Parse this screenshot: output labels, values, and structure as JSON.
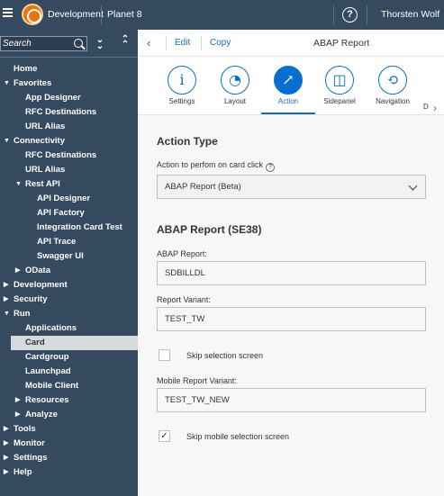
{
  "topbar": {
    "app_name": "Development",
    "space_name": "Planet 8",
    "user_name": "Thorsten Wolf",
    "help_glyph": "?"
  },
  "sidebar": {
    "search_placeholder": "Search",
    "selected_item": "Card",
    "items": [
      {
        "label": "Home",
        "level": 0,
        "arrow": ""
      },
      {
        "label": "Favorites",
        "level": 0,
        "arrow": "down"
      },
      {
        "label": "App Designer",
        "level": 1,
        "arrow": ""
      },
      {
        "label": "RFC Destinations",
        "level": 1,
        "arrow": ""
      },
      {
        "label": "URL Alias",
        "level": 1,
        "arrow": ""
      },
      {
        "label": "Connectivity",
        "level": 0,
        "arrow": "down"
      },
      {
        "label": "RFC Destinations",
        "level": 1,
        "arrow": ""
      },
      {
        "label": "URL Alias",
        "level": 1,
        "arrow": ""
      },
      {
        "label": "Rest API",
        "level": 1,
        "arrow": "down"
      },
      {
        "label": "API Designer",
        "level": 2,
        "arrow": ""
      },
      {
        "label": "API Factory",
        "level": 2,
        "arrow": ""
      },
      {
        "label": "Integration Card Test",
        "level": 2,
        "arrow": ""
      },
      {
        "label": "API Trace",
        "level": 2,
        "arrow": ""
      },
      {
        "label": "Swagger UI",
        "level": 2,
        "arrow": ""
      },
      {
        "label": "OData",
        "level": 1,
        "arrow": "right"
      },
      {
        "label": "Development",
        "level": 0,
        "arrow": "right"
      },
      {
        "label": "Security",
        "level": 0,
        "arrow": "right"
      },
      {
        "label": "Run",
        "level": 0,
        "arrow": "down"
      },
      {
        "label": "Applications",
        "level": 1,
        "arrow": ""
      },
      {
        "label": "Card",
        "level": 1,
        "arrow": ""
      },
      {
        "label": "Cardgroup",
        "level": 1,
        "arrow": ""
      },
      {
        "label": "Launchpad",
        "level": 1,
        "arrow": ""
      },
      {
        "label": "Mobile Client",
        "level": 1,
        "arrow": ""
      },
      {
        "label": "Resources",
        "level": 1,
        "arrow": "right"
      },
      {
        "label": "Analyze",
        "level": 1,
        "arrow": "right"
      },
      {
        "label": "Tools",
        "level": 0,
        "arrow": "right"
      },
      {
        "label": "Monitor",
        "level": 0,
        "arrow": "right"
      },
      {
        "label": "Settings",
        "level": 0,
        "arrow": "right"
      },
      {
        "label": "Help",
        "level": 0,
        "arrow": "right"
      }
    ]
  },
  "subheader": {
    "edit_label": "Edit",
    "copy_label": "Copy",
    "title": "ABAP Report"
  },
  "tabs": [
    {
      "label": "Settings",
      "icon": "info-icon",
      "glyph": "i"
    },
    {
      "label": "Layout",
      "icon": "palette-icon",
      "glyph": "◔"
    },
    {
      "label": "Action",
      "icon": "share-icon",
      "glyph": "↗"
    },
    {
      "label": "Sidepanel",
      "icon": "sidepanel-icon",
      "glyph": "◫"
    },
    {
      "label": "Navigation",
      "icon": "navigation-icon",
      "glyph": "⟲"
    },
    {
      "label": "D",
      "icon": "",
      "glyph": ""
    }
  ],
  "active_tab": "Action",
  "action": {
    "section_title": "Action Type",
    "label": "Action to perfom on card click",
    "value": "ABAP Report (Beta)"
  },
  "report": {
    "section_title": "ABAP Report (SE38)",
    "report_label": "ABAP Report:",
    "report_value": "SDBILLDL",
    "variant_label": "Report Variant:",
    "variant_value": "TEST_TW",
    "skip_label": "Skip selection screen",
    "skip_checked": false,
    "mobile_variant_label": "Mobile Report Variant:",
    "mobile_variant_value": "TEST_TW_NEW",
    "skip_mobile_label": "Skip mobile selection screen",
    "skip_mobile_checked": true
  },
  "colors": {
    "shell": "#354a5f",
    "accent": "#0a6ed1",
    "logo": "#e9730c"
  }
}
